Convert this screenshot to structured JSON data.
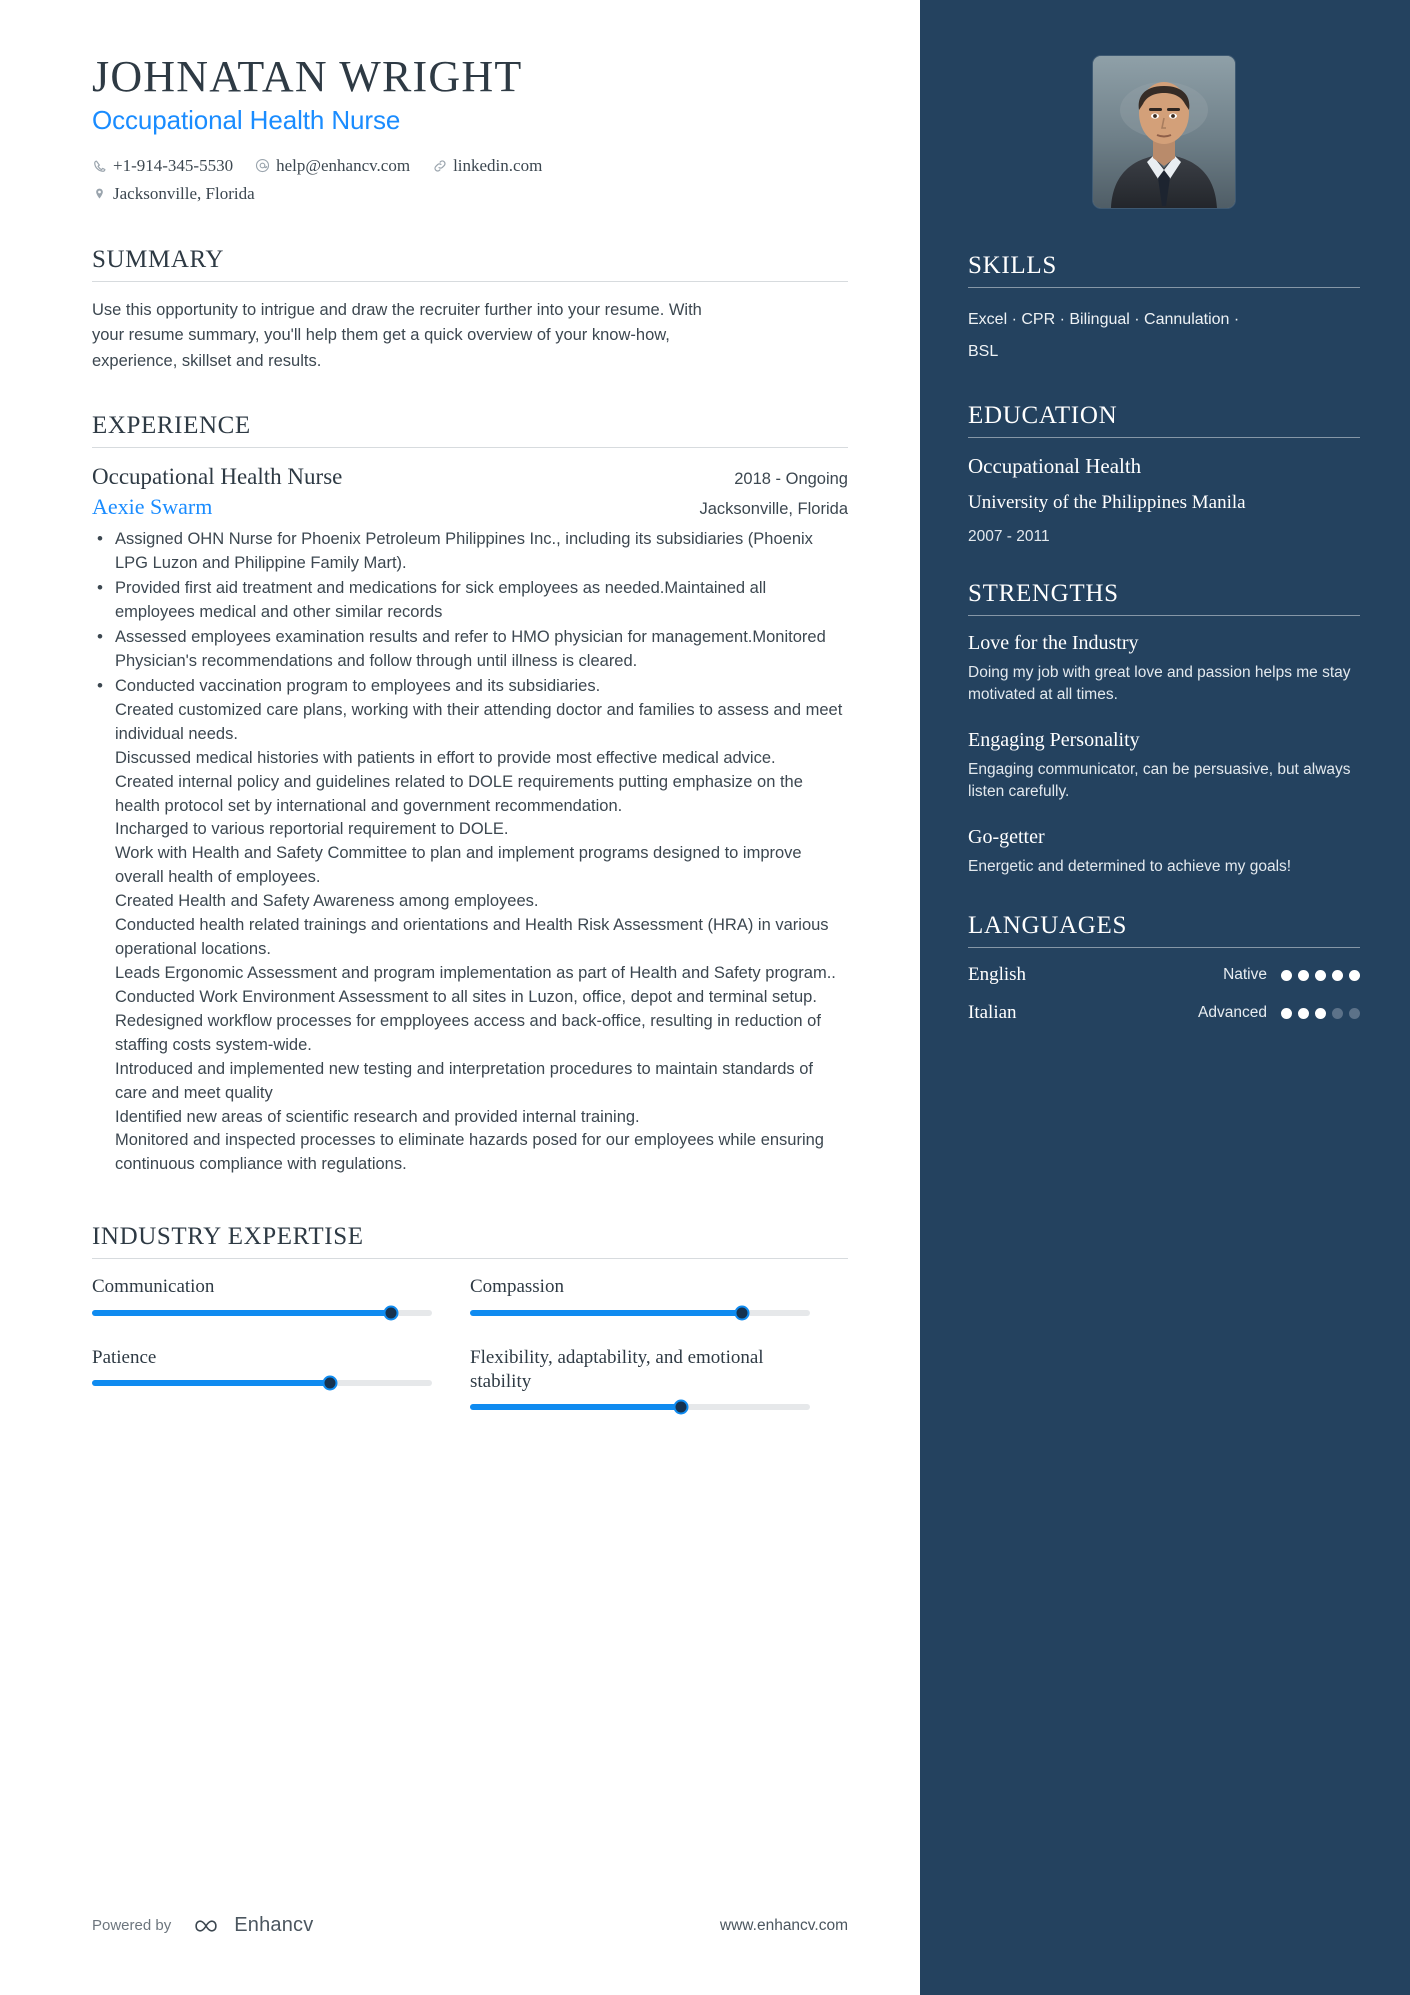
{
  "header": {
    "name": "JOHNATAN WRIGHT",
    "job_title": "Occupational Health Nurse",
    "contacts": [
      {
        "icon": "phone-icon",
        "text": "+1-914-345-5530"
      },
      {
        "icon": "email-icon",
        "text": "help@enhancv.com"
      },
      {
        "icon": "link-icon",
        "text": "linkedin.com"
      }
    ],
    "location": {
      "icon": "location-pin-icon",
      "text": "Jacksonville, Florida"
    }
  },
  "summary": {
    "title": "SUMMARY",
    "text": "Use this opportunity to intrigue and draw the recruiter further into your resume. With your resume summary, you'll help them get a quick overview of your know-how, experience, skillset and results."
  },
  "experience": {
    "title": "EXPERIENCE",
    "entries": [
      {
        "role": "Occupational Health Nurse",
        "dates": "2018 - Ongoing",
        "company": "Aexie Swarm",
        "location": "Jacksonville, Florida",
        "bullets": [
          {
            "text": "Assigned OHN Nurse for Phoenix Petroleum Philippines Inc., including its subsidiaries (Phoenix LPG Luzon and Philippine Family Mart)."
          },
          {
            "text": "Provided  first aid treatment and medications for sick employees as needed.Maintained all employees medical and other similar records"
          },
          {
            "text": "Assessed employees examination results and refer to HMO physician for management.Monitored Physician's recommendations and follow through until illness is cleared."
          },
          {
            "text": "Conducted vaccination program to employees and its subsidiaries.",
            "extra": [
              "Created customized care plans, working with their attending doctor and families to assess and meet individual needs.",
              "Discussed medical histories with patients in effort to provide most effective medical advice.",
              "Created internal policy and guidelines related to DOLE requirements putting emphasize on the health protocol set by international and government recommendation.",
              "Incharged to  various reportorial requirement to DOLE.",
              "Work with Health and Safety Committee to plan and implement programs designed to improve overall health of employees.",
              "Created Health and Safety Awareness among employees.",
              "Conducted health related trainings and orientations and  Health Risk Assessment (HRA) in various operational locations.",
              "Leads Ergonomic Assessment and program implementation as part of Health and Safety program..",
              "Conducted Work Environment Assessment to all sites in Luzon, office, depot and terminal setup.",
              "Redesigned workflow processes for empployees access and back-office, resulting in reduction of staffing costs system-wide.",
              "Introduced and implemented new testing and interpretation procedures to maintain standards of care and meet quality",
              "Identified new areas of scientific research and provided internal training.",
              "Monitored and inspected processes to eliminate hazards posed for our employees while ensuring continuous compliance with regulations."
            ]
          }
        ]
      }
    ]
  },
  "industry_expertise": {
    "title": "INDUSTRY EXPERTISE",
    "items": [
      {
        "name": "Communication",
        "value": 88
      },
      {
        "name": "Compassion",
        "value": 80
      },
      {
        "name": "Patience",
        "value": 70
      },
      {
        "name": "Flexibility, adaptability, and emotional stability",
        "value": 62
      }
    ]
  },
  "footer": {
    "powered_by": "Powered by",
    "brand": "Enhancv",
    "brand_mark": "infinity-logo-icon",
    "url": "www.enhancv.com"
  },
  "sidebar": {
    "photo": {
      "name": "profile-photo",
      "alt": "Portrait of a man in a suit and tie"
    },
    "skills": {
      "title": "SKILLS",
      "line1": "Excel · CPR · Bilingual · Cannulation ·",
      "line2": "BSL"
    },
    "education": {
      "title": "EDUCATION",
      "degree": "Occupational Health",
      "school": "University of the Philippines Manila",
      "years": "2007 - 2011"
    },
    "strengths": {
      "title": "STRENGTHS",
      "items": [
        {
          "name": "Love for the Industry",
          "desc": "Doing my job with great love and passion helps me stay motivated at all times."
        },
        {
          "name": "Engaging Personality",
          "desc": "Engaging communicator, can be persuasive, but always listen carefully."
        },
        {
          "name": "Go-getter",
          "desc": "Energetic and determined to achieve my goals!"
        }
      ]
    },
    "languages": {
      "title": "LANGUAGES",
      "items": [
        {
          "name": "English",
          "level": "Native",
          "filled": 5,
          "total": 5
        },
        {
          "name": "Italian",
          "level": "Advanced",
          "filled": 3,
          "total": 5
        }
      ]
    }
  },
  "colors": {
    "accent_blue": "#1a8cff",
    "sidebar_bg": "#24425f",
    "heading": "#2e3a44",
    "body_text": "#3c4750"
  }
}
